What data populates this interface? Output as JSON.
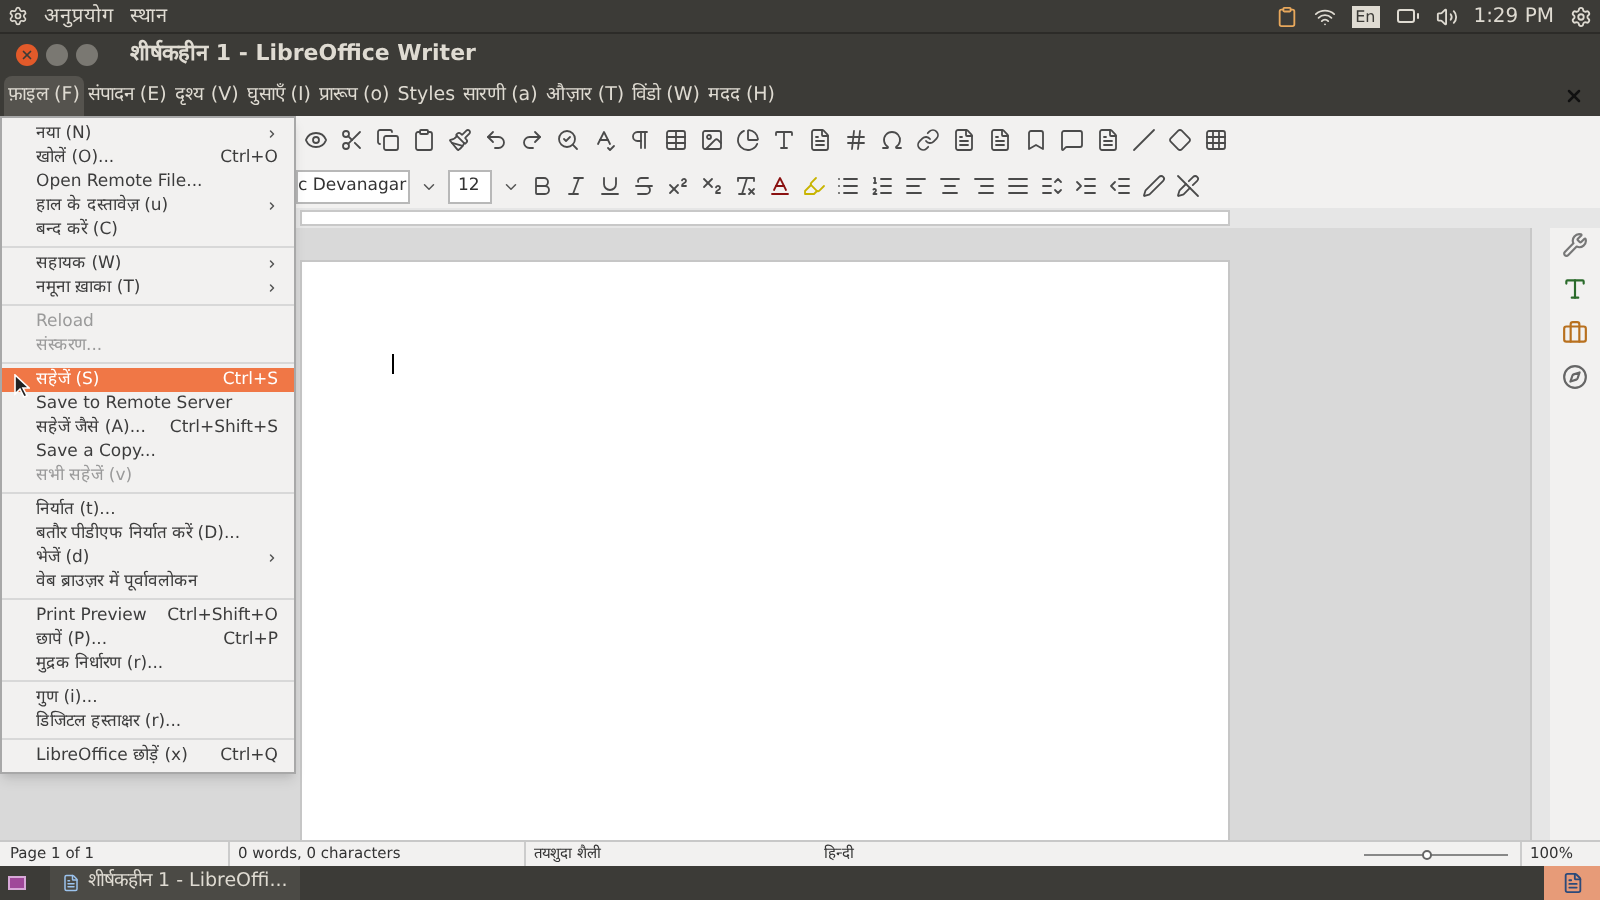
{
  "top_panel": {
    "menus": [
      "अनुप्रयोग",
      "स्थान"
    ],
    "keyboard": "En",
    "clock": "1:29 PM"
  },
  "window": {
    "title": "शीर्षकहीन 1 - LibreOffice Writer"
  },
  "menubar": [
    {
      "label": "फ़ाइल (F)",
      "selected": true
    },
    {
      "label": "संपादन (E)",
      "selected": false
    },
    {
      "label": "दृश्य (V)",
      "selected": false
    },
    {
      "label": "घुसाएँ (I)",
      "selected": false
    },
    {
      "label": "प्रारूप (o)",
      "selected": false
    },
    {
      "label": "Styles",
      "selected": false
    },
    {
      "label": "सारणी (a)",
      "selected": false
    },
    {
      "label": "औज़ार (T)",
      "selected": false
    },
    {
      "label": "विंडो (W)",
      "selected": false
    },
    {
      "label": "मदद (H)",
      "selected": false
    }
  ],
  "formatting": {
    "font_name": "c Devanagar",
    "font_size": "12"
  },
  "file_menu": [
    {
      "kind": "item",
      "label": "नया (N)",
      "submenu": true,
      "disabled": false,
      "selected": false
    },
    {
      "kind": "item",
      "label": "खोलें (O)...",
      "shortcut": "Ctrl+O",
      "disabled": false,
      "selected": false
    },
    {
      "kind": "item",
      "label": "Open Remote File...",
      "disabled": false,
      "selected": false
    },
    {
      "kind": "item",
      "label": "हाल के दस्तावेज़ (u)",
      "submenu": true,
      "disabled": false,
      "selected": false
    },
    {
      "kind": "item",
      "label": "बन्द करें (C)",
      "disabled": false,
      "selected": false
    },
    {
      "kind": "separator"
    },
    {
      "kind": "item",
      "label": "सहायक (W)",
      "submenu": true,
      "disabled": false,
      "selected": false
    },
    {
      "kind": "item",
      "label": "नमूना ख़ाका (T)",
      "submenu": true,
      "disabled": false,
      "selected": false
    },
    {
      "kind": "separator"
    },
    {
      "kind": "item",
      "label": "Reload",
      "disabled": true,
      "selected": false
    },
    {
      "kind": "item",
      "label": "संस्करण...",
      "disabled": true,
      "selected": false
    },
    {
      "kind": "separator"
    },
    {
      "kind": "item",
      "label": "सहेजें (S)",
      "shortcut": "Ctrl+S",
      "disabled": false,
      "selected": true
    },
    {
      "kind": "item",
      "label": "Save to Remote Server",
      "disabled": false,
      "selected": false
    },
    {
      "kind": "item",
      "label": "सहेजें जैसे (A)...",
      "shortcut": "Ctrl+Shift+S",
      "disabled": false,
      "selected": false
    },
    {
      "kind": "item",
      "label": "Save a Copy...",
      "disabled": false,
      "selected": false
    },
    {
      "kind": "item",
      "label": "सभी सहेजें (v)",
      "disabled": true,
      "selected": false
    },
    {
      "kind": "separator"
    },
    {
      "kind": "item",
      "label": "निर्यात (t)...",
      "disabled": false,
      "selected": false
    },
    {
      "kind": "item",
      "label": "बतौर पीडीएफ निर्यात करें (D)...",
      "disabled": false,
      "selected": false
    },
    {
      "kind": "item",
      "label": "भेजें (d)",
      "submenu": true,
      "disabled": false,
      "selected": false
    },
    {
      "kind": "item",
      "label": "वेब ब्राउज़र में पूर्वावलोकन",
      "disabled": false,
      "selected": false
    },
    {
      "kind": "separator"
    },
    {
      "kind": "item",
      "label": "Print Preview",
      "shortcut": "Ctrl+Shift+O",
      "disabled": false,
      "selected": false
    },
    {
      "kind": "item",
      "label": "छापें (P)...",
      "shortcut": "Ctrl+P",
      "disabled": false,
      "selected": false
    },
    {
      "kind": "item",
      "label": "मुद्रक निर्धारण (r)...",
      "disabled": false,
      "selected": false
    },
    {
      "kind": "separator"
    },
    {
      "kind": "item",
      "label": "गुण (i)...",
      "disabled": false,
      "selected": false
    },
    {
      "kind": "item",
      "label": "डिजिटल हस्ताक्षर (r)...",
      "disabled": false,
      "selected": false
    },
    {
      "kind": "separator"
    },
    {
      "kind": "item",
      "label": "LibreOffice छोड़ें (x)",
      "shortcut": "Ctrl+Q",
      "disabled": false,
      "selected": false
    }
  ],
  "status_bar": {
    "page": "Page 1 of 1",
    "words": "0 words, 0 characters",
    "style": "तयशुदा शैली",
    "language": "हिन्दी",
    "zoom": {
      "level": 0.45
    },
    "zoom_percent": "100%"
  },
  "taskbar": {
    "window_button": "शीर्षकहीन 1 - LibreOffi..."
  }
}
